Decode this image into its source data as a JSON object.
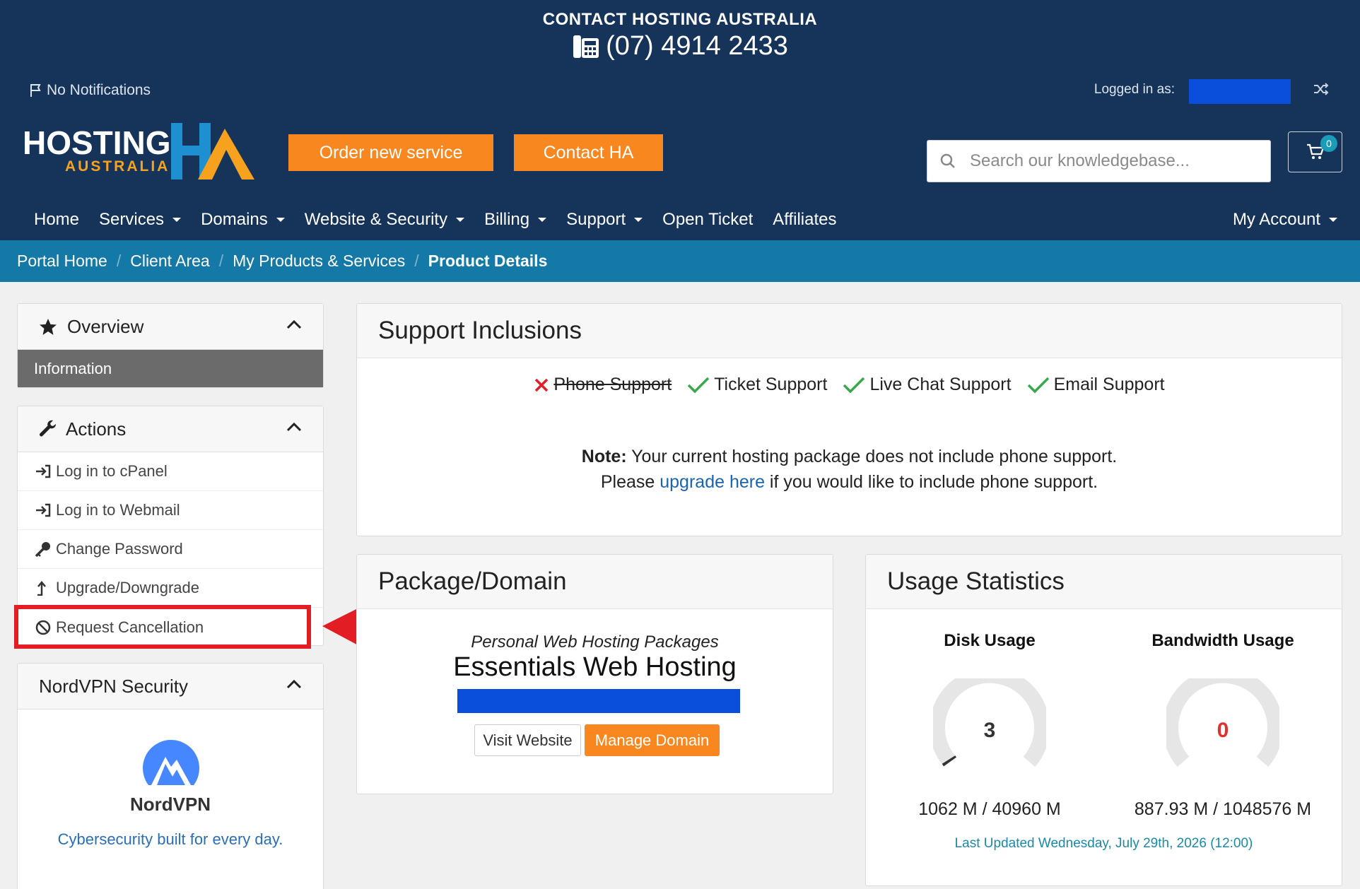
{
  "header": {
    "contact_title": "CONTACT HOSTING AUSTRALIA",
    "phone": "(07) 4914 2433",
    "notifications": "No Notifications",
    "logged_in_label": "Logged in as:",
    "logo_text": "HOSTING",
    "logo_sub": "AUSTRALIA",
    "order_button": "Order new service",
    "contact_button": "Contact HA",
    "search_placeholder": "Search our knowledgebase...",
    "cart_count": "0",
    "colors": {
      "header_bg": "#16345a",
      "accent": "#f7871e",
      "breadcrumb_bg": "#1479a6"
    }
  },
  "nav": {
    "home": "Home",
    "services": "Services",
    "domains": "Domains",
    "website_security": "Website & Security",
    "billing": "Billing",
    "support": "Support",
    "open_ticket": "Open Ticket",
    "affiliates": "Affiliates",
    "my_account": "My Account"
  },
  "breadcrumb": {
    "portal_home": "Portal Home",
    "client_area": "Client Area",
    "products": "My Products & Services",
    "current": "Product Details"
  },
  "sidebar": {
    "overview_title": "Overview",
    "overview_active": "Information",
    "actions_title": "Actions",
    "actions": {
      "cpanel": "Log in to cPanel",
      "webmail": "Log in to Webmail",
      "password": "Change Password",
      "upgrade": "Upgrade/Downgrade",
      "cancel": "Request Cancellation"
    },
    "nordvpn_title": "NordVPN Security",
    "nordvpn_brand": "NordVPN",
    "nordvpn_tagline": "Cybersecurity built for every day."
  },
  "support": {
    "title": "Support Inclusions",
    "phone": "Phone Support",
    "ticket": "Ticket Support",
    "chat": "Live Chat Support",
    "email": "Email Support",
    "note_label": "Note:",
    "note_text": " Your current hosting package does not include phone support.",
    "note_line2_pre": "Please ",
    "note_link": "upgrade here",
    "note_line2_post": " if you would like to include phone support."
  },
  "package": {
    "title": "Package/Domain",
    "group": "Personal Web Hosting Packages",
    "name": "Essentials Web Hosting",
    "visit_button": "Visit Website",
    "manage_button": "Manage Domain"
  },
  "usage": {
    "title": "Usage Statistics",
    "disk_title": "Disk Usage",
    "disk_value": "3",
    "disk_text": "1062 M / 40960 M",
    "bandwidth_title": "Bandwidth Usage",
    "bandwidth_value": "0",
    "bandwidth_text": "887.93 M / 1048576 M",
    "updated": "Last Updated Wednesday, July 29th, 2026 (12:00)"
  }
}
